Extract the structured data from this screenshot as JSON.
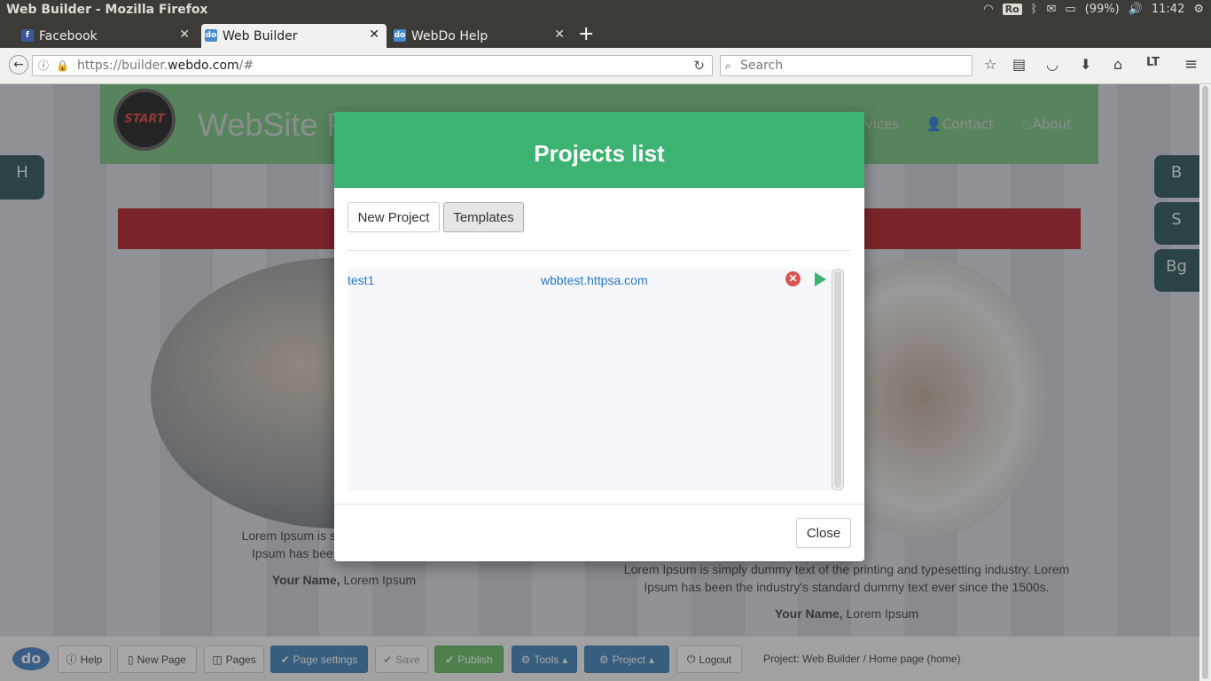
{
  "os": {
    "window_title": "Web Builder - Mozilla Firefox",
    "keyboard_layout": "Ro",
    "battery": "(99%)",
    "clock": "11:42"
  },
  "browser": {
    "tabs": [
      {
        "label": "Facebook",
        "icon": "facebook-icon"
      },
      {
        "label": "Web Builder",
        "icon": "webdo-icon"
      },
      {
        "label": "WebDo Help",
        "icon": "webdo-icon"
      }
    ],
    "url_prefix": "https://builder.",
    "url_host": "webdo.com",
    "url_suffix": "/#",
    "search_placeholder": "Search"
  },
  "site": {
    "logo_text": "START",
    "title": "WebSite F",
    "nav": [
      "Services",
      "Contact",
      "About"
    ],
    "left_text_1": "Lorem Ipsum is simply dummy text of",
    "left_text_2": "Ipsum has been the industry's sta",
    "left_author_bold": "Your Name,",
    "left_author": " Lorem Ipsum",
    "right_text_1": "Lorem Ipsum is simply dummy text of the printing and typesetting industry. Lorem",
    "right_text_2": "Ipsum has been the industry's standard dummy text ever since the 1500s.",
    "right_author_bold": "Your Name,",
    "right_author": " Lorem Ipsum"
  },
  "side_tabs": {
    "left": "H",
    "right": [
      "B",
      "S",
      "Bg"
    ]
  },
  "toolbar": {
    "logo": "do",
    "help": "Help",
    "new_page": "New Page",
    "pages": "Pages",
    "page_settings": "Page settings",
    "save": "Save",
    "publish": "Publish",
    "tools": "Tools",
    "project": "Project",
    "logout": "Logout",
    "status": "Project: Web Builder / Home page (home)"
  },
  "modal": {
    "title": "Projects list",
    "new_project": "New Project",
    "templates": "Templates",
    "projects": [
      {
        "name": "test1",
        "url": "wbbtest.httpsa.com"
      }
    ],
    "close": "Close"
  },
  "colors": {
    "modal_header": "#3cb371",
    "link": "#2a78c0",
    "delete": "#d9534f",
    "primary": "#337ab7",
    "success": "#5cb85c"
  }
}
